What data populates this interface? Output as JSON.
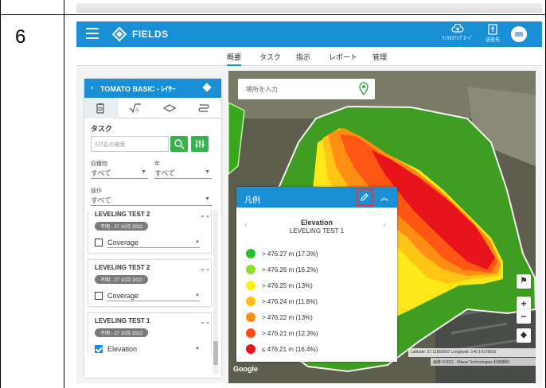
{
  "row_number": "6",
  "app": {
    "brand": "FIELDS",
    "topbar": {
      "upload_label": "ｸｼﾘｶｸｱｯﾌﾟﾛｰﾄﾞ",
      "send_label": "送信先"
    },
    "nav": [
      "概要",
      "タスク",
      "指示",
      "レポート",
      "管理"
    ],
    "nav_active": 0
  },
  "panel": {
    "back": "‹",
    "title": "TOMATO BASIC - ﾚｲﾔｰ",
    "task_label": "タスク",
    "search_placeholder": "ﾀｽｸ名の検索",
    "crop_label": "収穫物",
    "crop_value": "すべて",
    "year_label": "年",
    "year_value": "すべて",
    "op_label": "操作",
    "op_value": "すべて",
    "cards": [
      {
        "name": "LEVELING TEST 2",
        "date": "不明 - 27 10月 2022",
        "layer": "Coverage",
        "checked": false
      },
      {
        "name": "LEVELING TEST 2",
        "date": "不明 - 27 10月 2022",
        "layer": "Coverage",
        "checked": false
      },
      {
        "name": "LEVELING TEST 1",
        "date": "不明 - 27 10月 2022",
        "layer": "Elevation",
        "checked": true
      }
    ]
  },
  "map": {
    "search_placeholder": "場所を入力",
    "coords": "Latitude: 37.11863597  Longitude: 140.14178932",
    "attribution": "画像 ©2022 , Maxar Technologies  利用規約",
    "google": "Google"
  },
  "legend": {
    "header": "凡例",
    "title": "Elevation",
    "subtitle": "LEVELING TEST 1",
    "items": [
      {
        "label": "> 476.27 m (17.3%)",
        "color": "#22c02b"
      },
      {
        "label": "> 476.26 m (16.2%)",
        "color": "#8fe02c"
      },
      {
        "label": "> 476.25 m (13%)",
        "color": "#ffee10"
      },
      {
        "label": "> 476.24 m (11.8%)",
        "color": "#ffbf10"
      },
      {
        "label": "> 476.22 m (13%)",
        "color": "#ff8c10"
      },
      {
        "label": "> 476.21 m (12.3%)",
        "color": "#ff4a10"
      },
      {
        "label": "≤ 476.21 m (16.4%)",
        "color": "#e8141c"
      }
    ]
  },
  "colors": {
    "primary": "#1a8fd6",
    "green_button": "#37b24d",
    "highlight": "#e53935"
  }
}
